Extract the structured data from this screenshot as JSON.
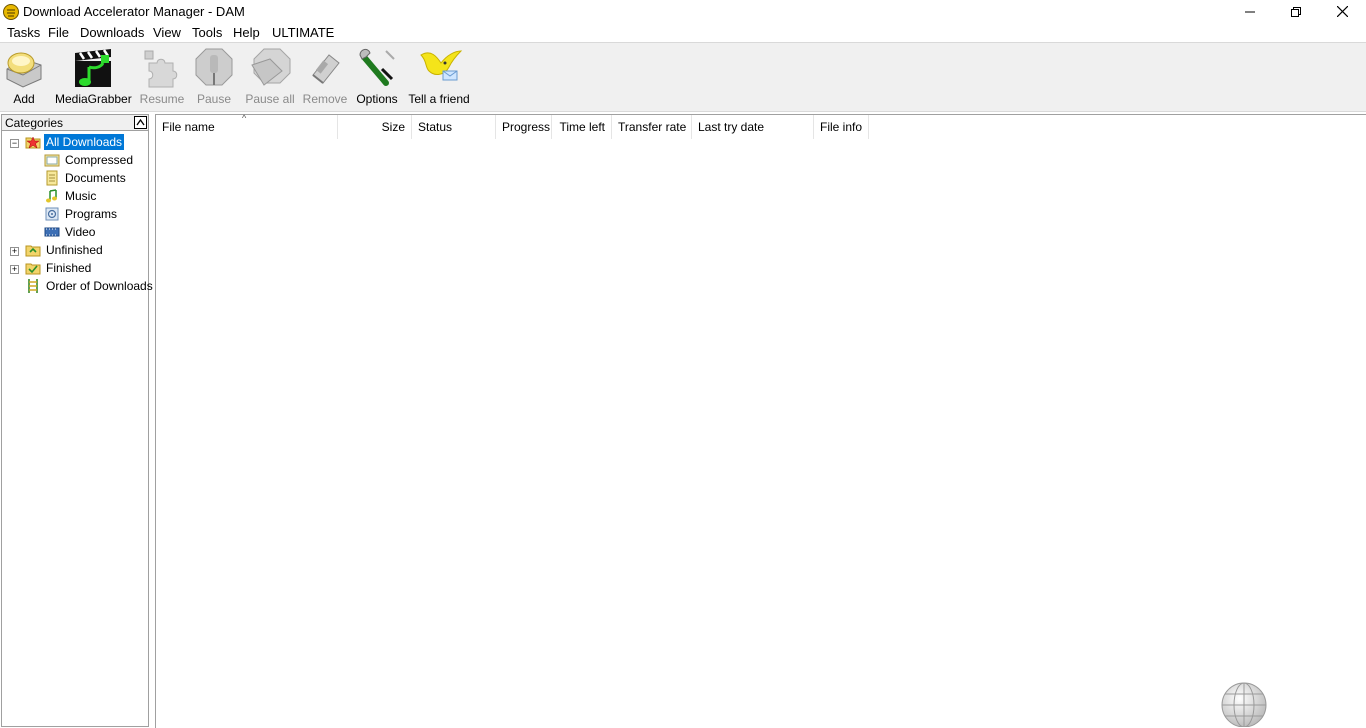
{
  "window": {
    "title": "Download Accelerator Manager - DAM"
  },
  "menu": {
    "items": [
      "Tasks",
      "File",
      "Downloads",
      "View",
      "Tools",
      "Help",
      "ULTIMATE"
    ]
  },
  "toolbar": {
    "add": "Add",
    "mediagrabber": "MediaGrabber",
    "resume": "Resume",
    "pause": "Pause",
    "pause_all": "Pause all",
    "remove": "Remove",
    "options": "Options",
    "tell_a_friend": "Tell a friend"
  },
  "categories": {
    "header": "Categories",
    "items": [
      {
        "label": "All Downloads",
        "icon": "star-folder-icon"
      },
      {
        "label": "Compressed",
        "icon": "compressed-folder-icon"
      },
      {
        "label": "Documents",
        "icon": "documents-icon"
      },
      {
        "label": "Music",
        "icon": "music-note-icon"
      },
      {
        "label": "Programs",
        "icon": "programs-icon"
      },
      {
        "label": "Video",
        "icon": "video-film-icon"
      },
      {
        "label": "Unfinished",
        "icon": "unfinished-folder-icon"
      },
      {
        "label": "Finished",
        "icon": "finished-folder-icon"
      },
      {
        "label": "Order of Downloads",
        "icon": "ladder-icon"
      }
    ]
  },
  "list": {
    "columns": [
      "File name",
      "Size",
      "Status",
      "Progress",
      "Time left",
      "Transfer rate",
      "Last try date",
      "File info"
    ],
    "sort_indicator": "^"
  },
  "colors": {
    "selection": "#0078d7",
    "toolbar_bg": "#f0f0f0",
    "disabled_text": "#8a8a8a"
  }
}
